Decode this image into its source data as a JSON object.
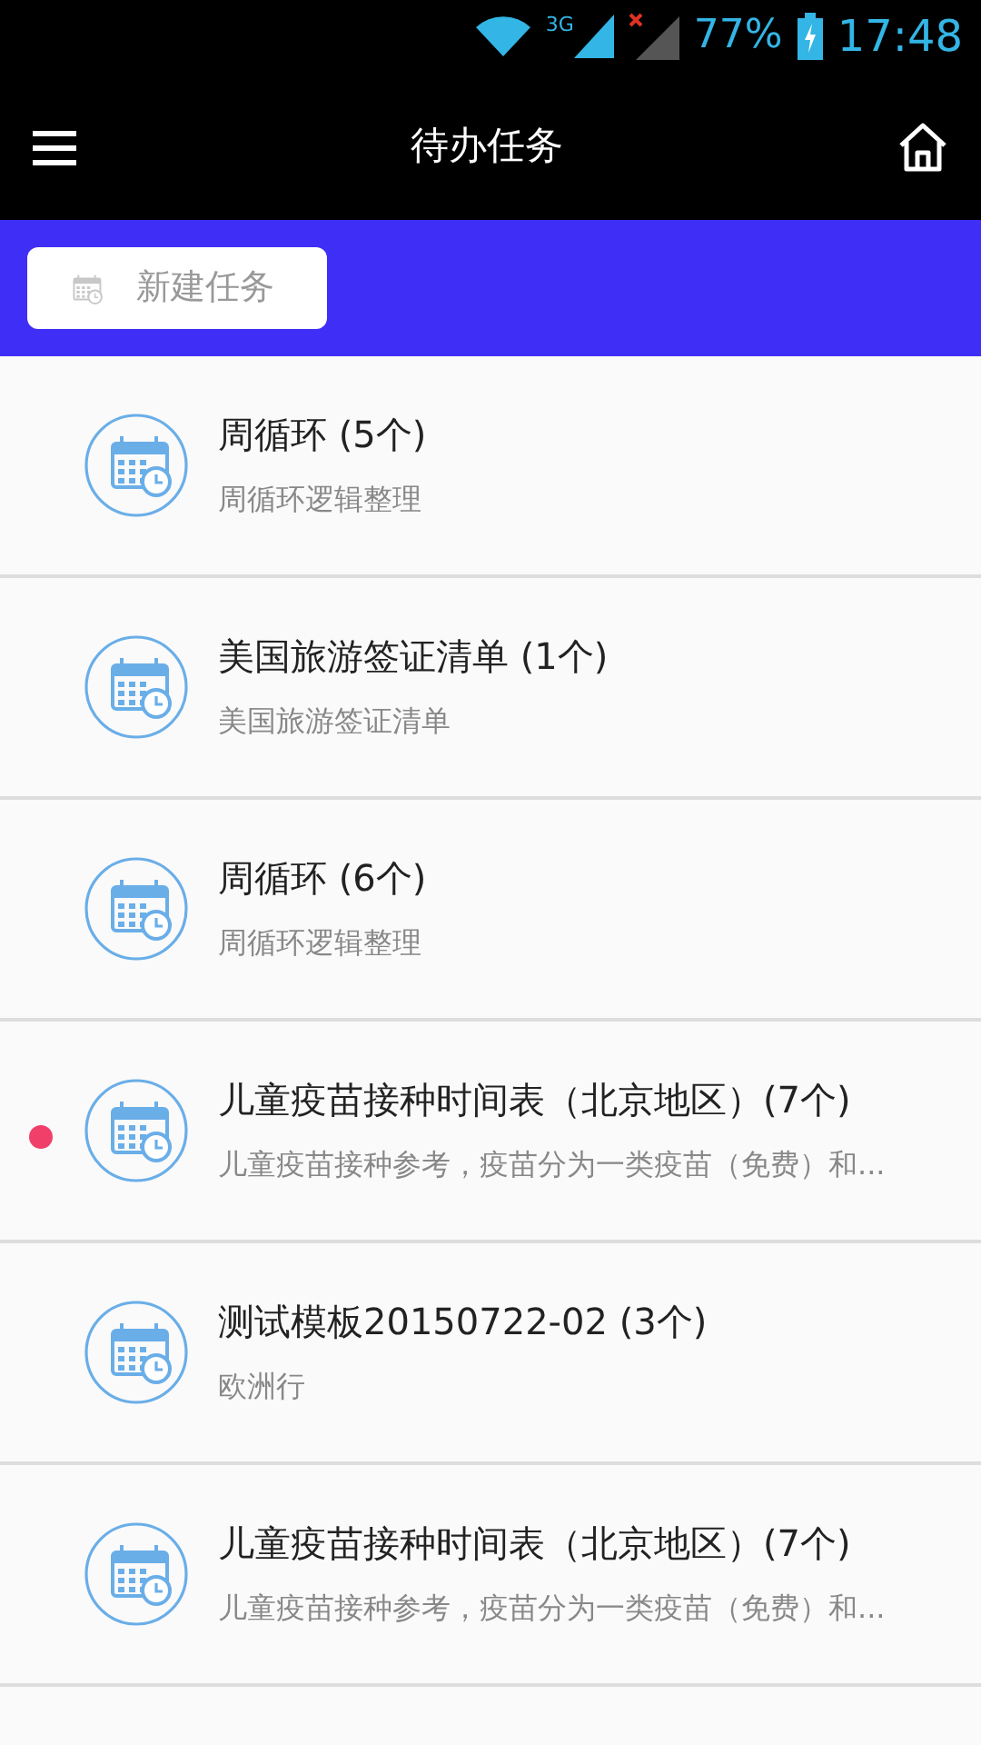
{
  "status_bar": {
    "network": "3G",
    "battery": "77%",
    "time": "17:48"
  },
  "header": {
    "title": "待办任务"
  },
  "new_task": {
    "label": "新建任务"
  },
  "tasks": [
    {
      "title": "周循环 (5个)",
      "subtitle": "周循环逻辑整理",
      "unread": false
    },
    {
      "title": "美国旅游签证清单 (1个)",
      "subtitle": "美国旅游签证清单",
      "unread": false
    },
    {
      "title": "周循环 (6个)",
      "subtitle": "周循环逻辑整理",
      "unread": false
    },
    {
      "title": "儿童疫苗接种时间表（北京地区）(7个)",
      "subtitle": "儿童疫苗接种参考，疫苗分为一类疫苗（免费）和...",
      "unread": true
    },
    {
      "title": "测试模板20150722-02 (3个)",
      "subtitle": "欧洲行",
      "unread": false
    },
    {
      "title": "儿童疫苗接种时间表（北京地区）(7个)",
      "subtitle": "儿童疫苗接种参考，疫苗分为一类疫苗（免费）和...",
      "unread": false
    }
  ]
}
